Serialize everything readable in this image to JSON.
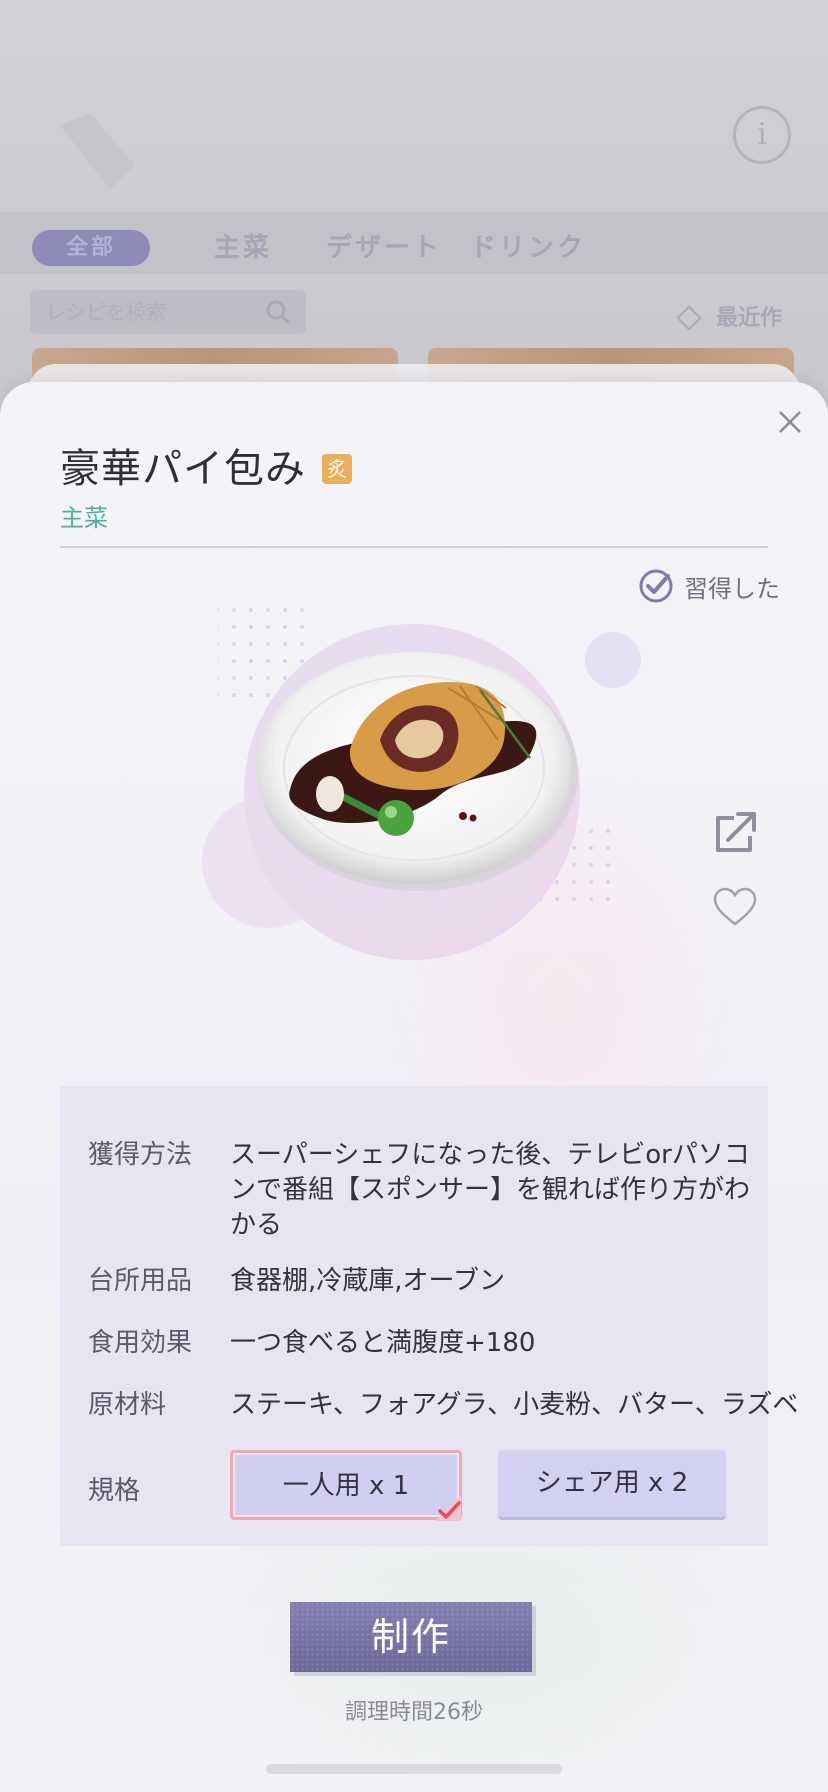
{
  "background": {
    "tabs": [
      "全部",
      "主菜",
      "デザート",
      "ドリンク"
    ],
    "search_placeholder": "レシピを検索",
    "favorites_label": "最近作"
  },
  "recipe": {
    "name": "豪華パイ包み",
    "badge": "炙",
    "category": "主菜",
    "learned_label": "習得した",
    "details": [
      {
        "label": "獲得方法",
        "value": "スーパーシェフになった後、テレビorパソコンで番組【スポンサー】を観れば作り方がわかる"
      },
      {
        "label": "台所用品",
        "value": "食器棚,冷蔵庫,オーブン"
      },
      {
        "label": "食用効果",
        "value": "一つ食べると満腹度+180"
      },
      {
        "label": "原材料",
        "value": "ステーキ、フォアグラ、小麦粉、バター、ラズベ"
      }
    ],
    "size": {
      "label": "規格",
      "options": [
        "一人用 x 1",
        "シェア用 x 2"
      ],
      "selected_index": 0
    },
    "make_label": "制作",
    "cook_time": "調理時間26秒"
  },
  "icons": {
    "close": "close-icon",
    "learned": "check-circle-icon",
    "share": "share-icon",
    "favorite": "heart-icon"
  },
  "colors": {
    "accent": "#6f6b9c",
    "category": "#4fb0a1",
    "badge": "#e8b05e",
    "selected_border": "#f0a8b4"
  }
}
